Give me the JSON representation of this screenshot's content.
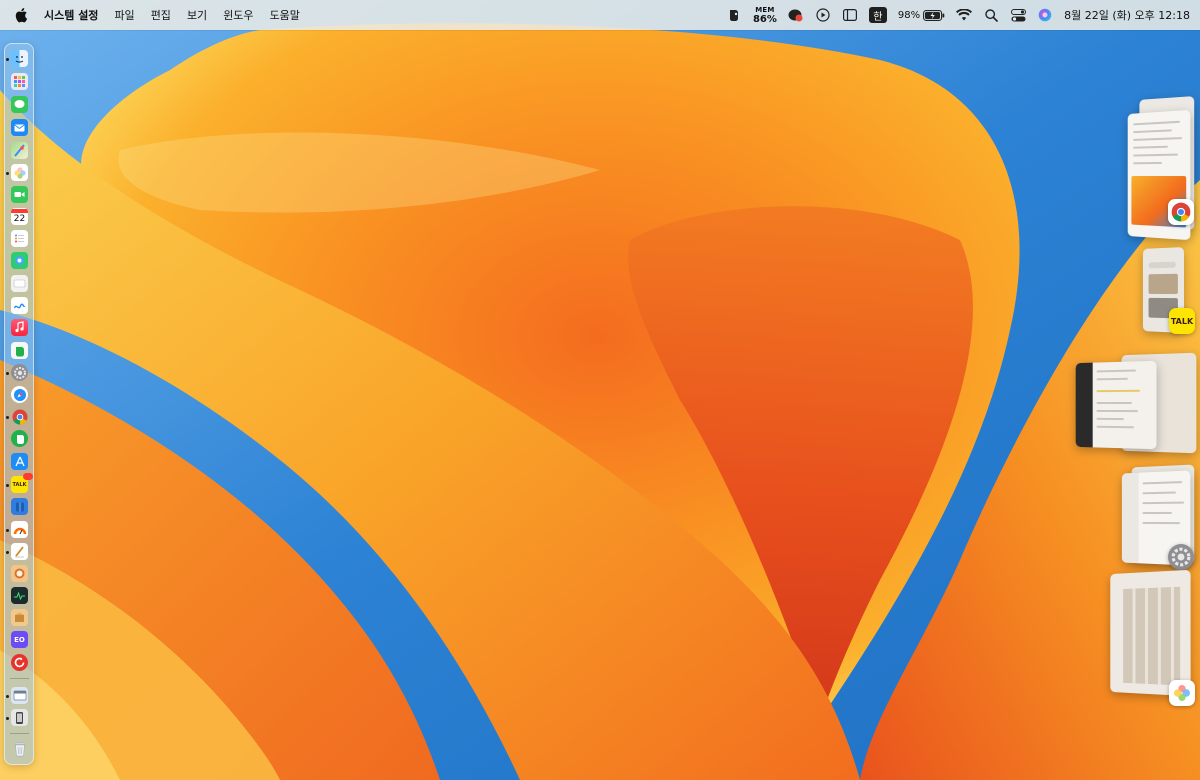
{
  "menubar": {
    "apple_icon": "apple-logo-icon",
    "app_name": "시스템 설정",
    "menus": [
      "파일",
      "편집",
      "보기",
      "윈도우",
      "도움말"
    ],
    "status": {
      "evernote_icon": "evernote-icon",
      "mem_label": "MEM",
      "mem_value": "86%",
      "notification_icon": "kakaotalk-icon",
      "play_icon": "play-icon",
      "sidebar_icon": "sidebar-icon",
      "input_method": "한",
      "battery_percent": "98%",
      "battery_icon": "battery-charging-icon",
      "wifi_icon": "wifi-icon",
      "search_icon": "search-icon",
      "control_center_icon": "control-center-icon",
      "siri_icon": "siri-icon",
      "datetime": "8월 22일 (화) 오후 12:18"
    }
  },
  "dock": {
    "calendar_day": "22",
    "kakaotalk_label": "TALK",
    "eo_label": "EO",
    "apps": [
      "finder",
      "launchpad",
      "messages",
      "mail",
      "maps",
      "photos",
      "facetime",
      "calendar",
      "reminders",
      "app-2",
      "app-3",
      "freeform",
      "music",
      "evernote-menu",
      "system-settings",
      "safari",
      "chrome",
      "evernote",
      "app-store",
      "kakaotalk",
      "app-4",
      "app-5",
      "textedit",
      "app-6",
      "activity-monitor",
      "app-7",
      "app-8",
      "app-9",
      "preview",
      "iphone-mirroring",
      "trash"
    ]
  },
  "stage_manager": {
    "groups": [
      {
        "app": "chrome",
        "app_icon": "chrome-icon"
      },
      {
        "app": "kakaotalk",
        "app_icon": "kakaotalk-icon",
        "icon_label": "TALK"
      },
      {
        "app": "notes",
        "app_icon": "notes-icon"
      },
      {
        "app": "system-settings",
        "app_icon": "gear-icon"
      },
      {
        "app": "photos",
        "app_icon": "photos-icon"
      }
    ]
  },
  "colors": {
    "wallpaper_blue": "#2f86d6",
    "wallpaper_orange": "#f7921c",
    "wallpaper_deep": "#e2481f",
    "wallpaper_yellow": "#fcd95c"
  }
}
